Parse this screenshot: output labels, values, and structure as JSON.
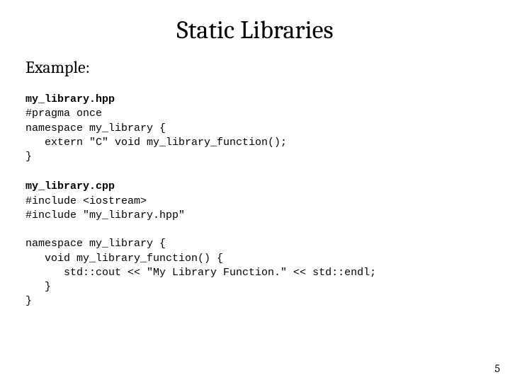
{
  "title": "Static Libraries",
  "subtitle": "Example:",
  "block1": {
    "filename": "my_library.hpp",
    "l1": "#pragma once",
    "l2": "namespace my_library {",
    "l3": "   extern \"C\" void my_library_function();",
    "l4": "}"
  },
  "block2": {
    "filename": "my_library.cpp",
    "l1": "#include <iostream>",
    "l2": "#include \"my_library.hpp\"",
    "l3": "",
    "l4": "namespace my_library {",
    "l5": "   void my_library_function() {",
    "l6": "      std::cout << \"My Library Function.\" << std::endl;",
    "l7": "   }",
    "l8": "}"
  },
  "page_number": "5"
}
